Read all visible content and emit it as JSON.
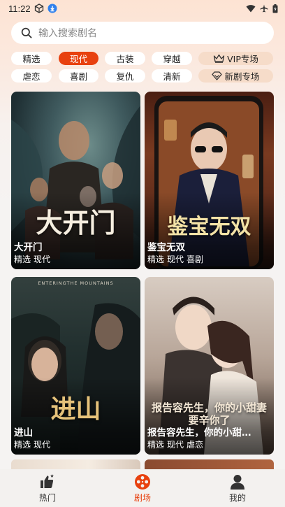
{
  "status_bar": {
    "time": "11:22"
  },
  "search": {
    "placeholder": "输入搜索剧名"
  },
  "filters": {
    "row1": [
      "精选",
      "现代",
      "古装",
      "穿越"
    ],
    "row2": [
      "虐恋",
      "喜剧",
      "复仇",
      "清新"
    ],
    "active": "现代",
    "vip_label": "VIP专场",
    "new_label": "新剧专场"
  },
  "dramas": [
    {
      "title": "大开门",
      "poster_text": "大开门",
      "tags": [
        "精选",
        "现代"
      ]
    },
    {
      "title": "鉴宝无双",
      "poster_text": "鉴宝无双",
      "tags": [
        "精选",
        "现代",
        "喜剧"
      ]
    },
    {
      "title": "进山",
      "poster_text": "进山",
      "poster_caption": "ENTERINGTHE MOUNTAINS",
      "tags": [
        "精选",
        "现代"
      ]
    },
    {
      "title": "报告容先生，你的小甜…",
      "poster_text": "报告容先生，你的小甜妻要辛你了",
      "tags": [
        "精选",
        "现代",
        "虐恋"
      ]
    }
  ],
  "bottom_nav": {
    "items": [
      {
        "label": "热门",
        "icon": "thumbs-up-icon"
      },
      {
        "label": "剧场",
        "icon": "film-reel-icon"
      },
      {
        "label": "我的",
        "icon": "user-icon"
      }
    ],
    "active": "剧场",
    "active_color": "#e8410f"
  }
}
